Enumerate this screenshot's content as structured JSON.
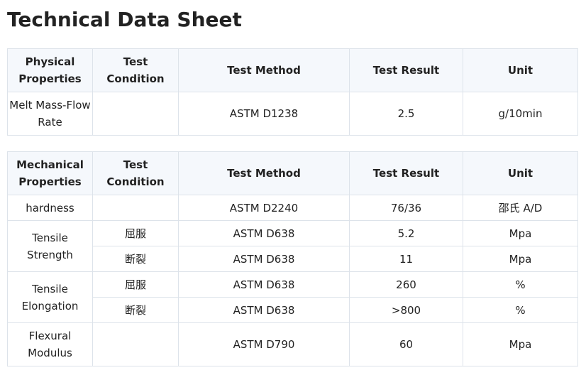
{
  "page": {
    "title": "Technical Data Sheet"
  },
  "physical": {
    "headers": [
      "Physical Properties",
      "Test Condition",
      "Test Method",
      "Test Result",
      "Unit"
    ],
    "rows": [
      {
        "property": "Melt Mass-Flow Rate",
        "condition": "",
        "method": "ASTM D1238",
        "result": "2.5",
        "unit": "g/10min"
      }
    ]
  },
  "mechanical": {
    "headers": [
      "Mechanical Properties",
      "Test Condition",
      "Test Method",
      "Test Result",
      "Unit"
    ],
    "hardness": {
      "property": "hardness",
      "condition": "",
      "method": "ASTM D2240",
      "result": "76/36",
      "unit": "邵氏 A/D"
    },
    "tensile_strength": {
      "property": "Tensile Strength",
      "rows": [
        {
          "condition": "屈服",
          "method": "ASTM D638",
          "result": "5.2",
          "unit": "Mpa"
        },
        {
          "condition": "断裂",
          "method": "ASTM D638",
          "result": "11",
          "unit": "Mpa"
        }
      ]
    },
    "tensile_elongation": {
      "property": "Tensile Elongation",
      "rows": [
        {
          "condition": "屈服",
          "method": "ASTM D638",
          "result": "260",
          "unit": "%"
        },
        {
          "condition": "断裂",
          "method": "ASTM D638",
          "result": ">800",
          "unit": "%"
        }
      ]
    },
    "flexural_modulus": {
      "property": "Flexural Modulus",
      "condition": "",
      "method": "ASTM D790",
      "result": "60",
      "unit": "Mpa"
    }
  }
}
